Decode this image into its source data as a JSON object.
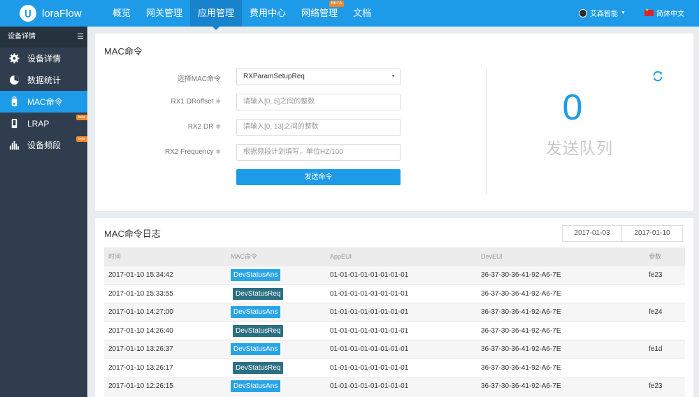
{
  "app": {
    "name": "loraFlow"
  },
  "nav": {
    "items": [
      {
        "label": "概览",
        "active": false
      },
      {
        "label": "网关管理",
        "active": false
      },
      {
        "label": "应用管理",
        "active": true
      },
      {
        "label": "费用中心",
        "active": false
      },
      {
        "label": "网络管理",
        "active": false,
        "badge": "BETA"
      },
      {
        "label": "文档",
        "active": false
      }
    ],
    "user": "艾森智能",
    "language": "简体中文"
  },
  "sidebar": {
    "header": "设备详情",
    "items": [
      {
        "label": "设备详情",
        "icon": "gear-icon"
      },
      {
        "label": "数据统计",
        "icon": "pie-chart-icon"
      },
      {
        "label": "MAC命令",
        "icon": "mac-command-icon",
        "active": true
      },
      {
        "label": "LRAP",
        "icon": "device-icon",
        "badge": "beta"
      },
      {
        "label": "设备频段",
        "icon": "bar-chart-icon",
        "badge": "beta"
      }
    ]
  },
  "mac": {
    "title": "MAC命令",
    "select_label": "选择MAC命令",
    "select_value": "RXParamSetupReq",
    "fields": [
      {
        "label": "RX1 DRoffset",
        "placeholder": "请输入[0, 5]之间的整数"
      },
      {
        "label": "RX2 DR",
        "placeholder": "请输入[0, 13]之间的整数"
      },
      {
        "label": "RX2 Frequency",
        "placeholder": "根据频段计划填写，单位HZ/100"
      }
    ],
    "send_label": "发送命令",
    "queue_count": "0",
    "queue_label": "发送队列"
  },
  "log": {
    "title": "MAC命令日志",
    "date_from": "2017-01-03",
    "date_to": "2017-01-10",
    "columns": [
      "时间",
      "MAC命令",
      "AppEUI",
      "DevEUI",
      "参数"
    ],
    "rows": [
      {
        "time": "2017-01-10 15:34:42",
        "cmd": "DevStatusAns",
        "app": "01-01-01-01-01-01-01-01",
        "dev": "36-37-30-36-41-92-A6-7E",
        "param": "fe23"
      },
      {
        "time": "2017-01-10 15:33:55",
        "cmd": "DevStatusReq",
        "app": "01-01-01-01-01-01-01-01",
        "dev": "36-37-30-36-41-92-A6-7E",
        "param": ""
      },
      {
        "time": "2017-01-10 14:27:00",
        "cmd": "DevStatusAns",
        "app": "01-01-01-01-01-01-01-01",
        "dev": "36-37-30-36-41-92-A6-7E",
        "param": "fe24"
      },
      {
        "time": "2017-01-10 14:26:40",
        "cmd": "DevStatusReq",
        "app": "01-01-01-01-01-01-01-01",
        "dev": "36-37-30-36-41-92-A6-7E",
        "param": ""
      },
      {
        "time": "2017-01-10 13:26:37",
        "cmd": "DevStatusAns",
        "app": "01-01-01-01-01-01-01-01",
        "dev": "36-37-30-36-41-92-A6-7E",
        "param": "fe1d"
      },
      {
        "time": "2017-01-10 13:26:17",
        "cmd": "DevStatusReq",
        "app": "01-01-01-01-01-01-01-01",
        "dev": "36-37-30-36-41-92-A6-7E",
        "param": ""
      },
      {
        "time": "2017-01-10 12:26:15",
        "cmd": "DevStatusAns",
        "app": "01-01-01-01-01-01-01-01",
        "dev": "36-37-30-36-41-92-A6-7E",
        "param": "fe23"
      }
    ]
  },
  "colors": {
    "primary": "#1e9be8",
    "sidebar": "#2f3d4e",
    "badge": "#f5872a",
    "ans_tag": "#29a4e6",
    "req_tag": "#2b6f82"
  }
}
